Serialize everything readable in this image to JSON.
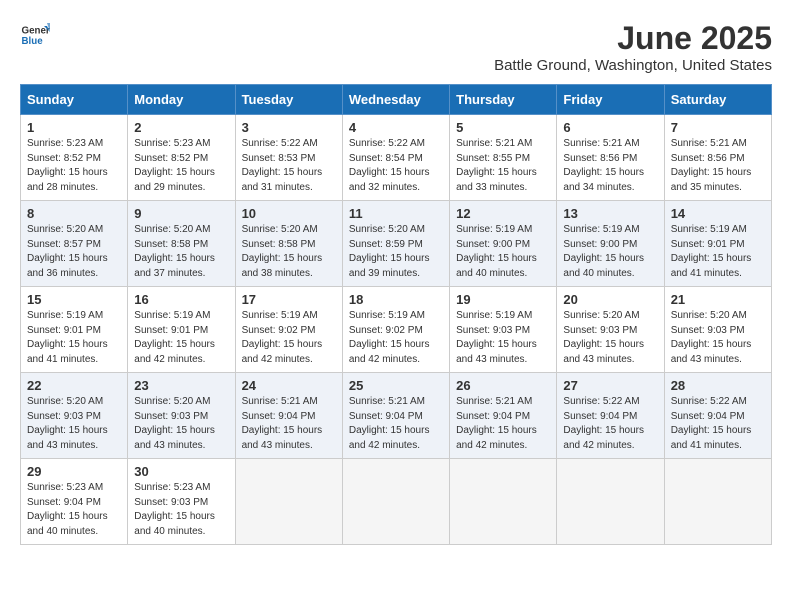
{
  "header": {
    "logo_general": "General",
    "logo_blue": "Blue",
    "title": "June 2025",
    "subtitle": "Battle Ground, Washington, United States"
  },
  "weekdays": [
    "Sunday",
    "Monday",
    "Tuesday",
    "Wednesday",
    "Thursday",
    "Friday",
    "Saturday"
  ],
  "rows": [
    [
      {
        "day": "1",
        "sunrise": "5:23 AM",
        "sunset": "8:52 PM",
        "daylight": "15 hours and 28 minutes."
      },
      {
        "day": "2",
        "sunrise": "5:23 AM",
        "sunset": "8:52 PM",
        "daylight": "15 hours and 29 minutes."
      },
      {
        "day": "3",
        "sunrise": "5:22 AM",
        "sunset": "8:53 PM",
        "daylight": "15 hours and 31 minutes."
      },
      {
        "day": "4",
        "sunrise": "5:22 AM",
        "sunset": "8:54 PM",
        "daylight": "15 hours and 32 minutes."
      },
      {
        "day": "5",
        "sunrise": "5:21 AM",
        "sunset": "8:55 PM",
        "daylight": "15 hours and 33 minutes."
      },
      {
        "day": "6",
        "sunrise": "5:21 AM",
        "sunset": "8:56 PM",
        "daylight": "15 hours and 34 minutes."
      },
      {
        "day": "7",
        "sunrise": "5:21 AM",
        "sunset": "8:56 PM",
        "daylight": "15 hours and 35 minutes."
      }
    ],
    [
      {
        "day": "8",
        "sunrise": "5:20 AM",
        "sunset": "8:57 PM",
        "daylight": "15 hours and 36 minutes."
      },
      {
        "day": "9",
        "sunrise": "5:20 AM",
        "sunset": "8:58 PM",
        "daylight": "15 hours and 37 minutes."
      },
      {
        "day": "10",
        "sunrise": "5:20 AM",
        "sunset": "8:58 PM",
        "daylight": "15 hours and 38 minutes."
      },
      {
        "day": "11",
        "sunrise": "5:20 AM",
        "sunset": "8:59 PM",
        "daylight": "15 hours and 39 minutes."
      },
      {
        "day": "12",
        "sunrise": "5:19 AM",
        "sunset": "9:00 PM",
        "daylight": "15 hours and 40 minutes."
      },
      {
        "day": "13",
        "sunrise": "5:19 AM",
        "sunset": "9:00 PM",
        "daylight": "15 hours and 40 minutes."
      },
      {
        "day": "14",
        "sunrise": "5:19 AM",
        "sunset": "9:01 PM",
        "daylight": "15 hours and 41 minutes."
      }
    ],
    [
      {
        "day": "15",
        "sunrise": "5:19 AM",
        "sunset": "9:01 PM",
        "daylight": "15 hours and 41 minutes."
      },
      {
        "day": "16",
        "sunrise": "5:19 AM",
        "sunset": "9:01 PM",
        "daylight": "15 hours and 42 minutes."
      },
      {
        "day": "17",
        "sunrise": "5:19 AM",
        "sunset": "9:02 PM",
        "daylight": "15 hours and 42 minutes."
      },
      {
        "day": "18",
        "sunrise": "5:19 AM",
        "sunset": "9:02 PM",
        "daylight": "15 hours and 42 minutes."
      },
      {
        "day": "19",
        "sunrise": "5:19 AM",
        "sunset": "9:03 PM",
        "daylight": "15 hours and 43 minutes."
      },
      {
        "day": "20",
        "sunrise": "5:20 AM",
        "sunset": "9:03 PM",
        "daylight": "15 hours and 43 minutes."
      },
      {
        "day": "21",
        "sunrise": "5:20 AM",
        "sunset": "9:03 PM",
        "daylight": "15 hours and 43 minutes."
      }
    ],
    [
      {
        "day": "22",
        "sunrise": "5:20 AM",
        "sunset": "9:03 PM",
        "daylight": "15 hours and 43 minutes."
      },
      {
        "day": "23",
        "sunrise": "5:20 AM",
        "sunset": "9:03 PM",
        "daylight": "15 hours and 43 minutes."
      },
      {
        "day": "24",
        "sunrise": "5:21 AM",
        "sunset": "9:04 PM",
        "daylight": "15 hours and 43 minutes."
      },
      {
        "day": "25",
        "sunrise": "5:21 AM",
        "sunset": "9:04 PM",
        "daylight": "15 hours and 42 minutes."
      },
      {
        "day": "26",
        "sunrise": "5:21 AM",
        "sunset": "9:04 PM",
        "daylight": "15 hours and 42 minutes."
      },
      {
        "day": "27",
        "sunrise": "5:22 AM",
        "sunset": "9:04 PM",
        "daylight": "15 hours and 42 minutes."
      },
      {
        "day": "28",
        "sunrise": "5:22 AM",
        "sunset": "9:04 PM",
        "daylight": "15 hours and 41 minutes."
      }
    ],
    [
      {
        "day": "29",
        "sunrise": "5:23 AM",
        "sunset": "9:04 PM",
        "daylight": "15 hours and 40 minutes."
      },
      {
        "day": "30",
        "sunrise": "5:23 AM",
        "sunset": "9:03 PM",
        "daylight": "15 hours and 40 minutes."
      },
      null,
      null,
      null,
      null,
      null
    ]
  ]
}
